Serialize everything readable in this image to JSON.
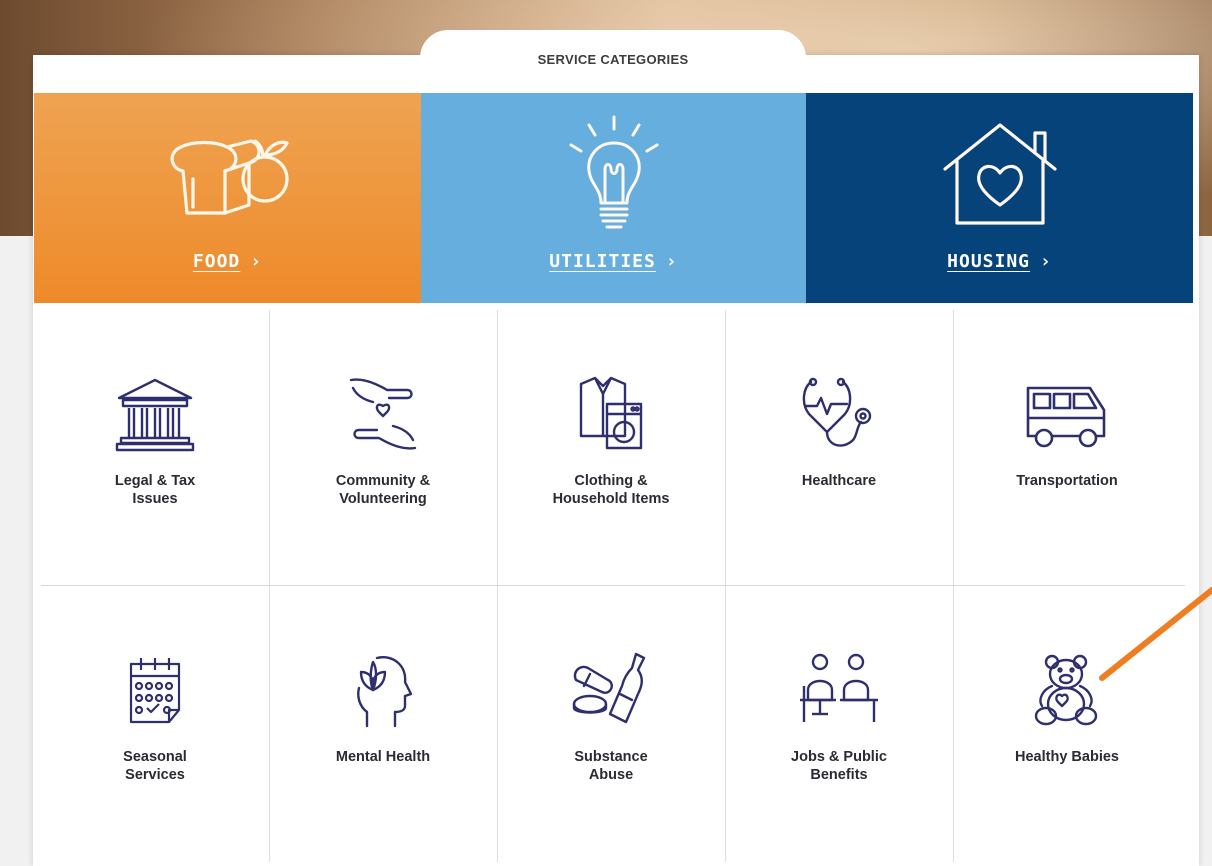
{
  "panel": {
    "title": "SERVICE CATEGORIES"
  },
  "featured": [
    {
      "label": "FOOD",
      "color": "#ee962f",
      "icon": "bread-apple-icon"
    },
    {
      "label": "UTILITIES",
      "color": "#65aede",
      "icon": "lightbulb-icon"
    },
    {
      "label": "HOUSING",
      "color": "#06437a",
      "icon": "house-heart-icon"
    }
  ],
  "categories": [
    {
      "label_line1": "Legal & Tax",
      "label_line2": "Issues",
      "icon": "courthouse-icon"
    },
    {
      "label_line1": "Community &",
      "label_line2": "Volunteering",
      "icon": "hands-heart-icon"
    },
    {
      "label_line1": "Clothing &",
      "label_line2": "Household Items",
      "icon": "clothing-washer-icon"
    },
    {
      "label_line1": "Healthcare",
      "label_line2": "",
      "icon": "stethoscope-icon"
    },
    {
      "label_line1": "Transportation",
      "label_line2": "",
      "icon": "bus-icon"
    },
    {
      "label_line1": "Seasonal",
      "label_line2": "Services",
      "icon": "calendar-icon"
    },
    {
      "label_line1": "Mental Health",
      "label_line2": "",
      "icon": "head-lotus-icon"
    },
    {
      "label_line1": "Substance",
      "label_line2": "Abuse",
      "icon": "pills-bottle-icon"
    },
    {
      "label_line1": "Jobs & Public",
      "label_line2": "Benefits",
      "icon": "interview-icon"
    },
    {
      "label_line1": "Healthy Babies",
      "label_line2": "",
      "icon": "teddy-bear-icon"
    }
  ],
  "colors": {
    "icon_stroke": "#2e2f6e",
    "annotation_arrow": "#ef7d22"
  },
  "arrow_symbol": "›"
}
